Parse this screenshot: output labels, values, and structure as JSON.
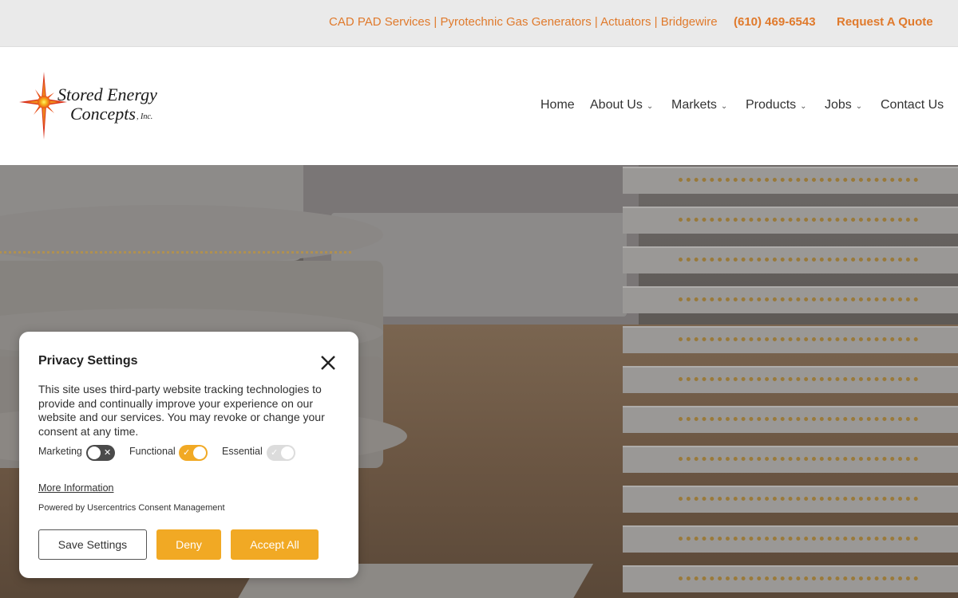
{
  "topbar": {
    "services": "CAD PAD Services | Pyrotechnic Gas Generators | Actuators | Bridgewire",
    "phone": "(610) 469-6543",
    "quote": "Request A Quote"
  },
  "logo": {
    "line1": "Stored Energy",
    "line2": "Concepts",
    "suffix": ", Inc."
  },
  "nav": {
    "items": [
      {
        "label": "Home",
        "dropdown": false
      },
      {
        "label": "About Us",
        "dropdown": true
      },
      {
        "label": "Markets",
        "dropdown": true
      },
      {
        "label": "Products",
        "dropdown": true
      },
      {
        "label": "Jobs",
        "dropdown": true
      },
      {
        "label": "Contact Us",
        "dropdown": false
      }
    ]
  },
  "modal": {
    "title": "Privacy Settings",
    "body": "This site uses third-party website tracking technologies to provide and continually improve your experience on our website and our services. You may revoke or change your consent at any time.",
    "toggles": [
      {
        "label": "Marketing",
        "state": "off"
      },
      {
        "label": "Functional",
        "state": "on"
      },
      {
        "label": "Essential",
        "state": "on-disabled"
      }
    ],
    "more_info": "More Information",
    "powered_by": "Powered by Usercentrics Consent Management",
    "buttons": {
      "save": "Save Settings",
      "deny": "Deny",
      "accept": "Accept All"
    }
  },
  "colors": {
    "accent_orange": "#e07a2c",
    "button_yellow": "#f1a924",
    "toggle_off": "#4a4a4a",
    "toggle_disabled": "#dcdcdc"
  }
}
